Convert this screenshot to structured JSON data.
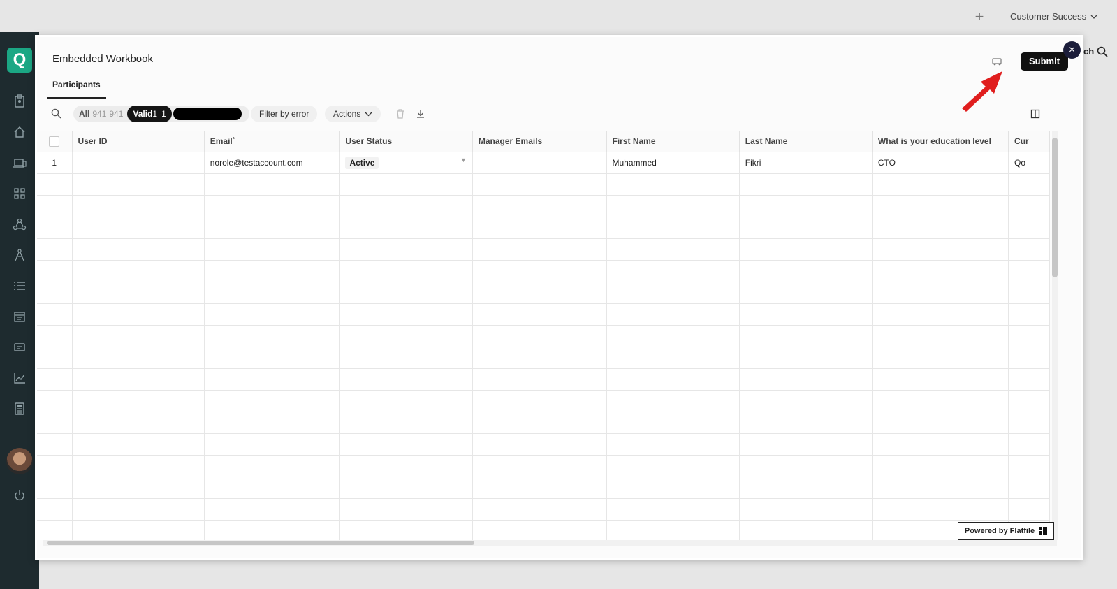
{
  "topbar": {
    "add_icon": "plus-icon",
    "account_label": "Customer Success"
  },
  "background": {
    "search_text": "rch"
  },
  "modal": {
    "title": "Embedded Workbook",
    "tab": "Participants",
    "submit_label": "Submit",
    "close_label": "×",
    "filters": {
      "all_label": "All",
      "all_count": "941",
      "all_count2": "941",
      "valid_label": "Valid",
      "valid_count": "1",
      "valid_count2": "1"
    },
    "filter_by_error": "Filter by error",
    "actions_label": "Actions",
    "columns": [
      "User ID",
      "Email",
      "User Status",
      "Manager Emails",
      "First Name",
      "Last Name",
      "What is your education level",
      "Cur"
    ],
    "email_required_mark": "*",
    "rows": [
      {
        "num": "1",
        "user_id": "",
        "email": "norole@testaccount.com",
        "status": "Active",
        "manager": "",
        "first": "Muhammed",
        "last": "Fikri",
        "education": "CTO",
        "extra": "Qo"
      }
    ],
    "powered_by": "Powered by Flatfile"
  },
  "colors": {
    "sidebar_bg": "#1e2b2f",
    "brand_accent": "#1ba784",
    "submit_bg": "#111111",
    "arrow": "#e01e1e",
    "close_bg": "#1b1d3a"
  }
}
